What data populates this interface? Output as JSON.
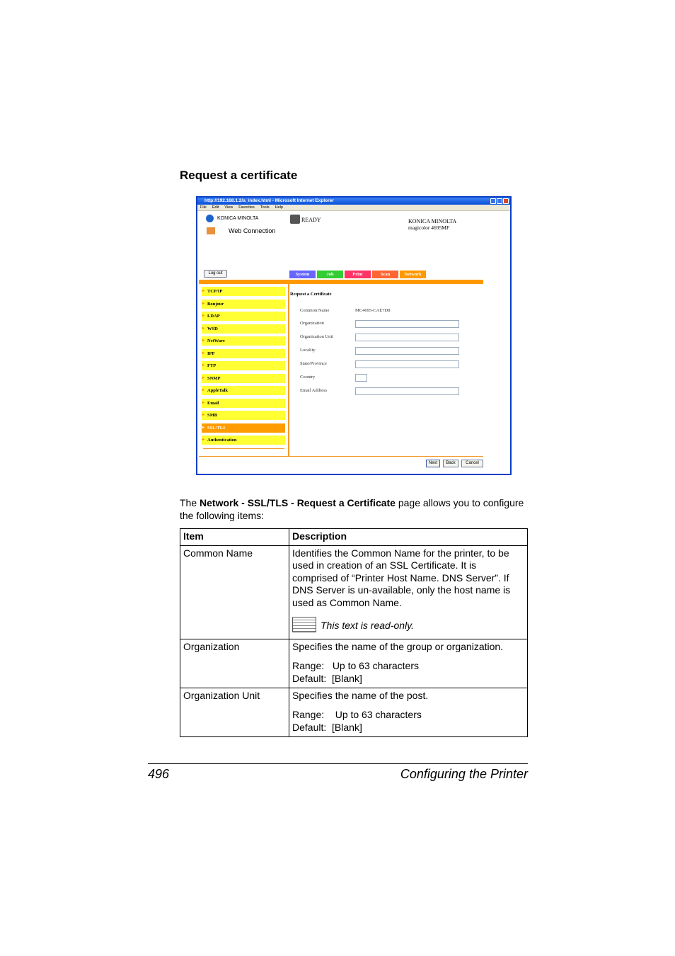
{
  "heading": "Request a certificate",
  "browser": {
    "title": "http://192.168.1.2/a_index.html - Microsoft Internet Explorer",
    "menu": [
      "File",
      "Edit",
      "View",
      "Favorites",
      "Tools",
      "Help"
    ]
  },
  "app": {
    "brand": "KONICA MINOLTA",
    "product": "Web Connection",
    "status": "READY",
    "model_line1": "KONICA MINOLTA",
    "model_line2": "magicolor 4695MF",
    "logout": "Log out",
    "tabs": [
      {
        "label": "System",
        "color": "#6666ff"
      },
      {
        "label": "Job",
        "color": "#33cc33"
      },
      {
        "label": "Print",
        "color": "#ff3366"
      },
      {
        "label": "Scan",
        "color": "#ff6633"
      },
      {
        "label": "Network",
        "color": "#ff9900"
      }
    ],
    "sidebar": [
      "TCP/IP",
      "Bonjour",
      "LDAP",
      "WSD",
      "NetWare",
      "IPP",
      "FTP",
      "SNMP",
      "AppleTalk",
      "Email",
      "SMB",
      "SSL/TLS",
      "Authentication"
    ],
    "active_sidebar": "SSL/TLS",
    "form_title": "Request a Certificate",
    "common_name_label": "Common Name",
    "common_name_value": "MC4695-CAE7D8",
    "fields": [
      "Organization",
      "Organization Unit",
      "Locality",
      "State/Province",
      "Country",
      "Email Address"
    ],
    "buttons": {
      "next": "Next",
      "back": "Back",
      "cancel": "Cancel"
    }
  },
  "intro": {
    "pre": "The ",
    "bold": "Network - SSL/TLS - Request a Certificate",
    "post": " page allows you to configure the following items:"
  },
  "table": {
    "headers": [
      "Item",
      "Description"
    ],
    "rows": [
      {
        "item": "Common Name",
        "desc": "Identifies the Common Name for the printer, to be used in creation of an SSL Certificate. It is comprised of “Printer Host Name. DNS Server”. If DNS Server is un-available, only the host name is used as Common Name.",
        "note": "This text is read-only."
      },
      {
        "item": "Organization",
        "desc": "Specifies the name of the group or organization.",
        "range": "Range:   Up to 63 characters",
        "default": "Default:  [Blank]"
      },
      {
        "item": "Organization Unit",
        "desc": "Specifies the name of the post.",
        "range": "Range:    Up to 63 characters",
        "default": "Default:  [Blank]"
      }
    ]
  },
  "footer": {
    "page": "496",
    "title": "Configuring the Printer"
  }
}
